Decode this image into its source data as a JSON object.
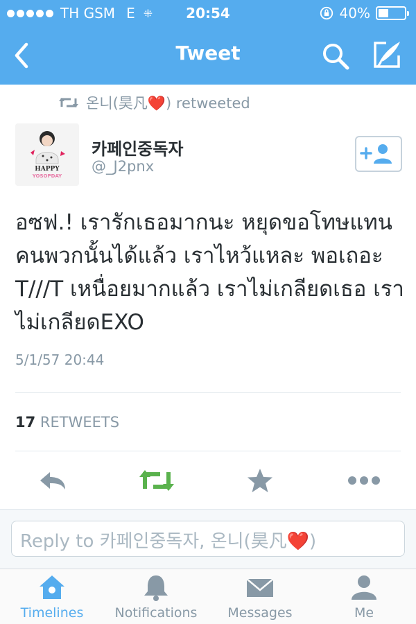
{
  "status_bar": {
    "carrier": "TH GSM",
    "network": "E",
    "time": "20:54",
    "battery_text": "40%",
    "battery_level": 0.4
  },
  "nav": {
    "title": "Tweet",
    "icons": [
      "back-icon",
      "search-icon",
      "compose-icon"
    ]
  },
  "tweet": {
    "retweeted_by": "온니(昊凡",
    "retweeted_suffix": ") retweeted",
    "author_name": "카페인중독자",
    "author_handle": "@_J2pnx",
    "avatar_text": "HAPPY",
    "avatar_subtext": "YOSOPDAY",
    "text": "อซฟ.! เรารักเธอมากนะ หยุดขอโทษแทนคนพวกนั้นได้แล้ว เราไหว้แหละ พอเถอะ T///T เหนื่อยมากแล้ว เราไม่เกลียดเธอ เราไม่เกลียดEXO",
    "timestamp": "5/1/57 20:44",
    "retweet_count": "17",
    "retweet_label": "RETWEETS"
  },
  "reply": {
    "placeholder_prefix": "Reply to 카페인중독자, 온니(昊凡",
    "placeholder_suffix": ")"
  },
  "heart_glyph": "❤️",
  "tabs": [
    {
      "label": "Timelines",
      "icon": "home-icon",
      "active": true
    },
    {
      "label": "Notifications",
      "icon": "bell-icon",
      "active": false
    },
    {
      "label": "Messages",
      "icon": "envelope-icon",
      "active": false
    },
    {
      "label": "Me",
      "icon": "person-icon",
      "active": false
    }
  ],
  "colors": {
    "brand_blue": "#55acee",
    "retweet_green": "#5ab24d",
    "icon_gray": "#8899a6",
    "heart_red": "#e0245e"
  }
}
